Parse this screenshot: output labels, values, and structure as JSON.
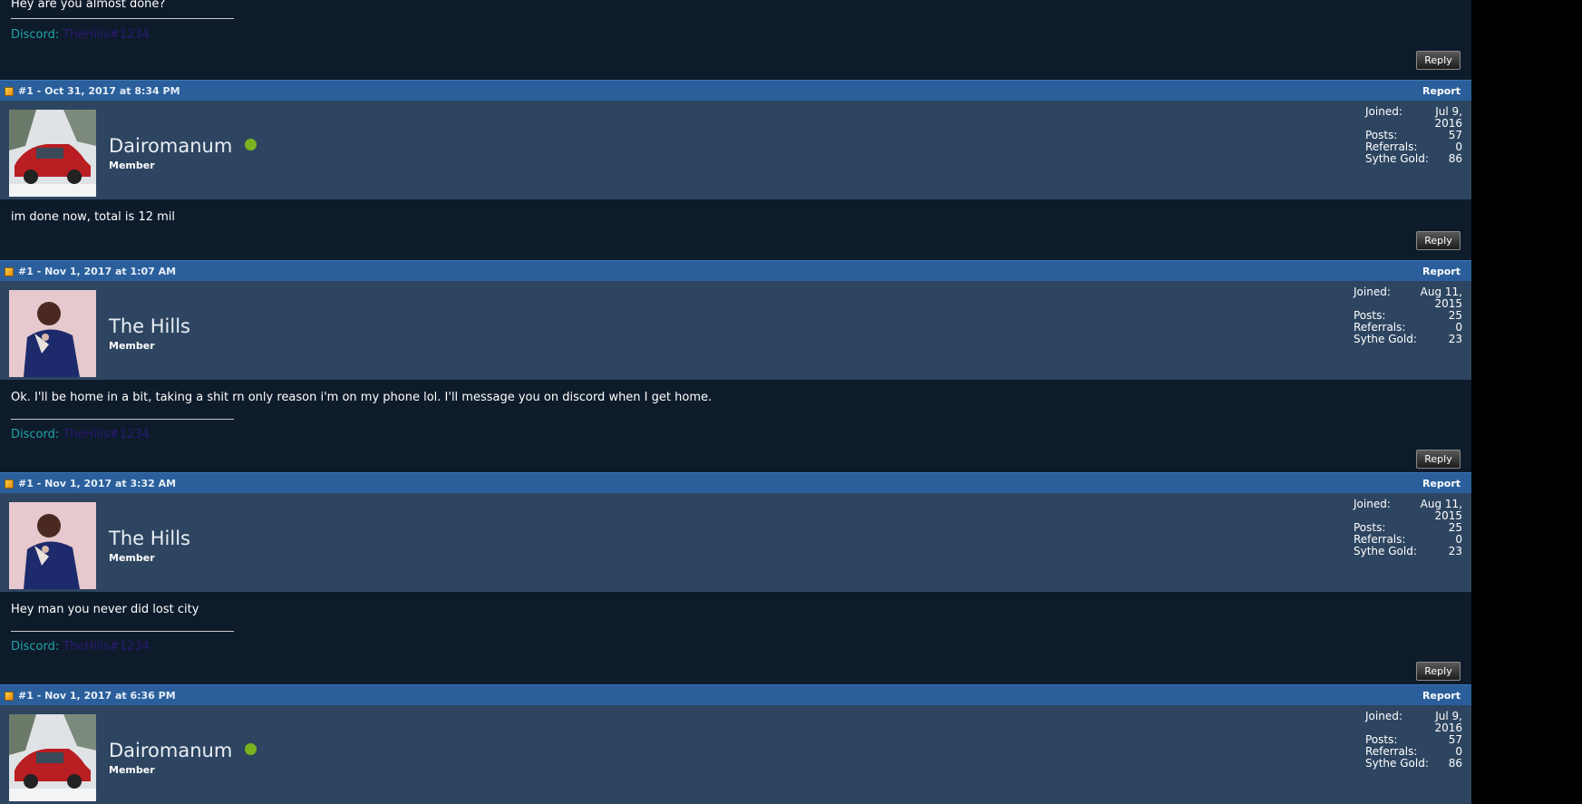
{
  "colors": {
    "header_bar": "#2a5f9b",
    "user_block": "#2d4560",
    "post_body": "#0e1b2b",
    "discord_label": "#1fa5a5",
    "online": "#7bb320"
  },
  "buttons": {
    "reply": "Reply",
    "report": "Report"
  },
  "top_fragment": {
    "text": "Hey are you almost done?",
    "discord_label": "Discord:",
    "discord_value": "TheHills#1234"
  },
  "posts": [
    {
      "meta": "#1 - Oct 31, 2017 at 8:34 PM",
      "username": "Dairomanum",
      "online": true,
      "role": "Member",
      "avatar": "red-car-avatar",
      "stats": {
        "joined_label": "Joined:",
        "joined": "Jul 9, 2016",
        "posts_label": "Posts:",
        "posts": "57",
        "referrals_label": "Referrals:",
        "referrals": "0",
        "gold_label": "Sythe Gold:",
        "gold": "86"
      },
      "text": "im done now, total is 12 mil"
    },
    {
      "meta": "#1 - Nov 1, 2017 at 1:07 AM",
      "username": "The Hills",
      "online": false,
      "role": "Member",
      "avatar": "person-avatar",
      "stats": {
        "joined_label": "Joined:",
        "joined": "Aug 11, 2015",
        "posts_label": "Posts:",
        "posts": "25",
        "referrals_label": "Referrals:",
        "referrals": "0",
        "gold_label": "Sythe Gold:",
        "gold": "23"
      },
      "text": "Ok. I'll be home in a bit, taking a shit rn only reason i'm on my phone lol. I'll message you on discord when I get home.",
      "discord_label": "Discord:",
      "discord_value": "TheHills#1234"
    },
    {
      "meta": "#1 - Nov 1, 2017 at 3:32 AM",
      "username": "The Hills",
      "online": false,
      "role": "Member",
      "avatar": "person-avatar",
      "stats": {
        "joined_label": "Joined:",
        "joined": "Aug 11, 2015",
        "posts_label": "Posts:",
        "posts": "25",
        "referrals_label": "Referrals:",
        "referrals": "0",
        "gold_label": "Sythe Gold:",
        "gold": "23"
      },
      "text": "Hey man you never did lost city",
      "discord_label": "Discord:",
      "discord_value": "TheHills#1234"
    },
    {
      "meta": "#1 - Nov 1, 2017 at 6:36 PM",
      "username": "Dairomanum",
      "online": true,
      "role": "Member",
      "avatar": "red-car-avatar",
      "stats": {
        "joined_label": "Joined:",
        "joined": "Jul 9, 2016",
        "posts_label": "Posts:",
        "posts": "57",
        "referrals_label": "Referrals:",
        "referrals": "0",
        "gold_label": "Sythe Gold:",
        "gold": "86"
      }
    }
  ]
}
